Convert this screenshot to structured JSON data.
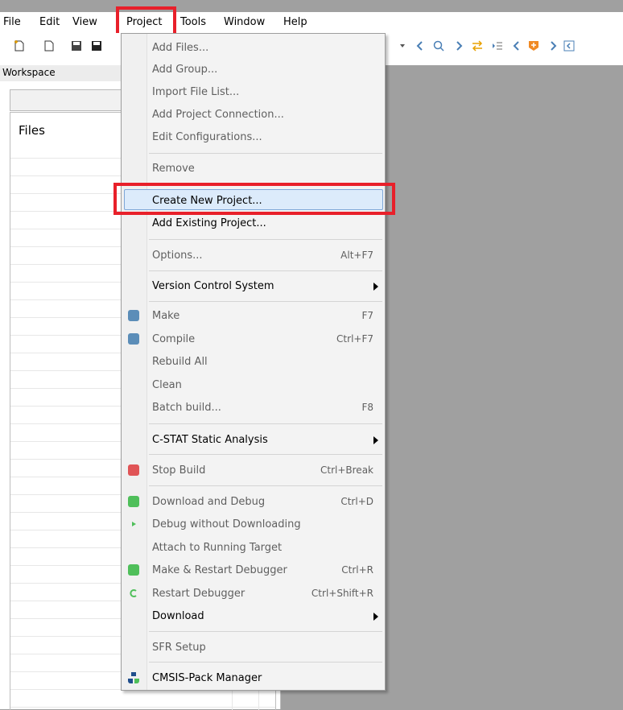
{
  "menubar": {
    "items": [
      "File",
      "Edit",
      "View",
      "Project",
      "Tools",
      "Window",
      "Help"
    ]
  },
  "workspace": {
    "title": "Workspace",
    "files_label": "Files"
  },
  "menu": {
    "items": [
      {
        "label": "Add Files...",
        "shortcut": "",
        "enabled": false
      },
      {
        "label": "Add Group...",
        "shortcut": "",
        "enabled": false
      },
      {
        "label": "Import File List...",
        "shortcut": "",
        "enabled": false
      },
      {
        "label": "Add Project Connection...",
        "shortcut": "",
        "enabled": false
      },
      {
        "label": "Edit Configurations...",
        "shortcut": "",
        "enabled": false
      },
      {
        "label": "Remove",
        "shortcut": "",
        "enabled": false
      },
      {
        "label": "Create New Project...",
        "shortcut": "",
        "enabled": true
      },
      {
        "label": "Add Existing Project...",
        "shortcut": "",
        "enabled": true
      },
      {
        "label": "Options...",
        "shortcut": "Alt+F7",
        "enabled": false
      },
      {
        "label": "Version Control System",
        "shortcut": "",
        "enabled": true
      },
      {
        "label": "Make",
        "shortcut": "F7",
        "enabled": false
      },
      {
        "label": "Compile",
        "shortcut": "Ctrl+F7",
        "enabled": false
      },
      {
        "label": "Rebuild All",
        "shortcut": "",
        "enabled": false
      },
      {
        "label": "Clean",
        "shortcut": "",
        "enabled": false
      },
      {
        "label": "Batch build...",
        "shortcut": "F8",
        "enabled": false
      },
      {
        "label": "C-STAT Static Analysis",
        "shortcut": "",
        "enabled": true
      },
      {
        "label": "Stop Build",
        "shortcut": "Ctrl+Break",
        "enabled": false
      },
      {
        "label": "Download and Debug",
        "shortcut": "Ctrl+D",
        "enabled": false
      },
      {
        "label": "Debug without Downloading",
        "shortcut": "",
        "enabled": false
      },
      {
        "label": "Attach to Running Target",
        "shortcut": "",
        "enabled": false
      },
      {
        "label": "Make & Restart Debugger",
        "shortcut": "Ctrl+R",
        "enabled": false
      },
      {
        "label": "Restart Debugger",
        "shortcut": "Ctrl+Shift+R",
        "enabled": false
      },
      {
        "label": "Download",
        "shortcut": "",
        "enabled": true
      },
      {
        "label": "SFR Setup",
        "shortcut": "",
        "enabled": false
      },
      {
        "label": "CMSIS-Pack Manager",
        "shortcut": "",
        "enabled": true
      }
    ]
  },
  "colors": {
    "highlight_box": "#e8202a",
    "menu_hover": "#dcebfb"
  }
}
